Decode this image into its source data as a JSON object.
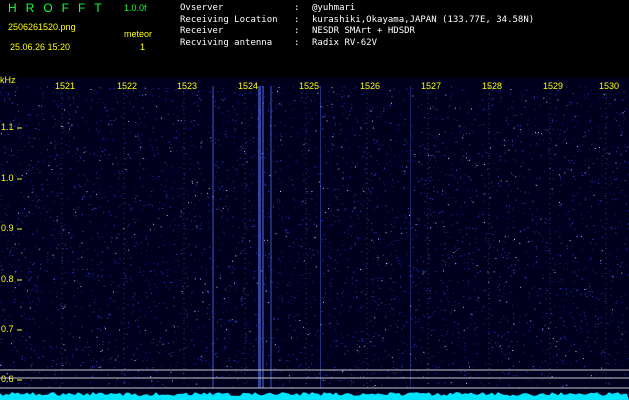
{
  "header": {
    "app_title": "HROFFT",
    "version": "1.0.0f",
    "filename": "2506261520.png",
    "datetime": "25.06.26 15:20",
    "counter_label": "meteor",
    "counter_value": "1"
  },
  "meta": [
    {
      "key": "Ovserver",
      "value": "@yuhmari"
    },
    {
      "key": "Receiving Location",
      "value": "kurashiki,Okayama,JAPAN (133.77E, 34.58N)"
    },
    {
      "key": "Receiver",
      "value": "NESDR SMArt + HDSDR"
    },
    {
      "key": "Recviving antenna",
      "value": "Radix RV-62V"
    }
  ],
  "plot": {
    "y_unit": "kHz",
    "y_ticks": [
      "1.1",
      "1.0",
      "0.9",
      "0.8",
      "0.7",
      "0.6"
    ],
    "x_ticks": [
      "1521",
      "1522",
      "1523",
      "1524",
      "1525",
      "1526",
      "1527",
      "1528",
      "1529",
      "1530"
    ],
    "colors": {
      "background": "#00001e",
      "signal": "#5a78ff",
      "baseline": "#00e5ff",
      "tick": "#ffff00"
    }
  }
}
